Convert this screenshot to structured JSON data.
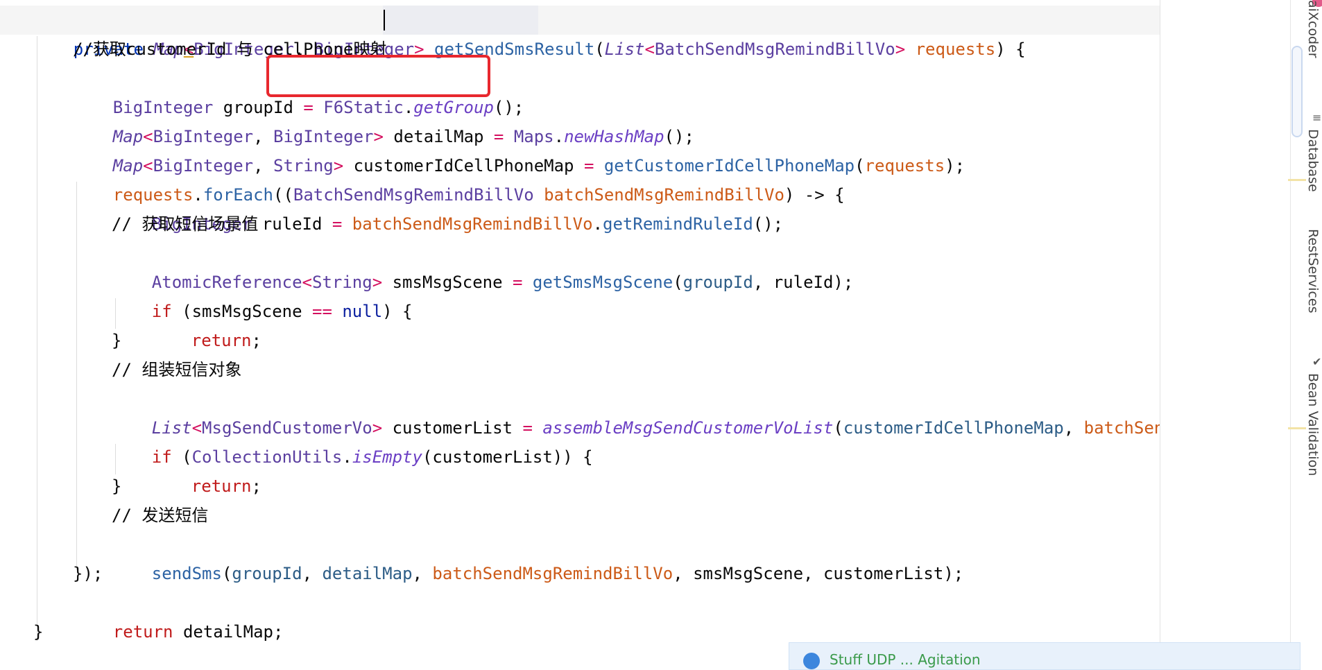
{
  "editor": {
    "method_signature": {
      "modifier": "private",
      "return_type": "Map",
      "lt": "<",
      "key_type": "BigInteger",
      "comma": ", ",
      "value_type": "BigInteger",
      "gt": ">",
      "method_name": "getSendSmsResult",
      "paren_open": "(",
      "param_type": "List",
      "param_generic_lt": "<",
      "param_generic": "BatchSendMsgRemindBillVo",
      "param_generic_gt": ">",
      "param_name": "requests",
      "tail": ") {"
    },
    "lines": {
      "l2_comment": "//获取customerId 与 cellPhone映射",
      "l3": {
        "type": "BigInteger",
        "name": " groupId ",
        "eq": "=",
        "cls": " F6Static",
        "dot": ".",
        "call": "getGroup",
        "tail": "();"
      },
      "l4": {
        "type": "Map",
        "lt": "<",
        "t1": "BigInteger",
        "c": ", ",
        "t2": "BigInteger",
        "gt": ">",
        "name": " detailMap ",
        "eq": "=",
        "cls": " Maps",
        "dot": ".",
        "call": "newHashMap",
        "tail": "();"
      },
      "l5": {
        "type": "Map",
        "lt": "<",
        "t1": "BigInteger",
        "c": ", ",
        "t2": "String",
        "gt": ">",
        "name": " customerIdCellPhoneMap ",
        "eq": "=",
        "call": " getCustomerIdCellPhoneMap",
        "po": "(",
        "arg": "requests",
        "tail": ");"
      },
      "l6": {
        "obj": "requests",
        "dot": ".",
        "call": "forEach",
        "po": "((",
        "type": "BatchSendMsgRemindBillVo",
        "sp": " ",
        "param": "batchSendMsgRemindBillVo",
        "tail": ") -> {"
      },
      "l7": {
        "type": "BigInteger",
        "name": " ruleId ",
        "eq": "=",
        "obj": " batchSendMsgRemindBillVo",
        "dot": ".",
        "call": "getRemindRuleId",
        "tail": "();"
      },
      "l8_comment": "// 获取短信场景值",
      "l9": {
        "type": "AtomicReference",
        "lt": "<",
        "t1": "String",
        "gt": ">",
        "name": " smsMsgScene ",
        "eq": "=",
        "call": " getSmsMsgScene",
        "po": "(",
        "a1": "groupId",
        "c": ", ",
        "a2": "ruleId",
        "tail": ");"
      },
      "l10": {
        "kw": "if",
        "po": " (smsMsgScene ",
        "op": "==",
        "sp": " ",
        "null": "null",
        "tail": ") {"
      },
      "l11": {
        "kw": "return",
        "tail": ";"
      },
      "l12": "}",
      "l13_comment": "// 组装短信对象",
      "l14": {
        "type": "List",
        "lt": "<",
        "t1": "MsgSendCustomerVo",
        "gt": ">",
        "name": " customerList ",
        "eq": "=",
        "call": " assembleMsgSendCustomerVoList",
        "po": "(",
        "a1": "customerIdCellPhoneMap",
        "c": ", ",
        "a2": "batchSendMsgRemindBillVo",
        "tail": ");"
      },
      "l15": {
        "kw": "if",
        "po": " (",
        "cls": "CollectionUtils",
        "dot": ".",
        "call": "isEmpty",
        "tail": "(customerList)) {"
      },
      "l16": {
        "kw": "return",
        "tail": ";"
      },
      "l17": "}",
      "l18_comment": "// 发送短信",
      "l19": {
        "call": "sendSms",
        "po": "(",
        "a1": "groupId",
        "c1": ", ",
        "a2": "detailMap",
        "c2": ", ",
        "a3": "batchSendMsgRemindBillVo",
        "rest": ", smsMsgScene, customerList);"
      },
      "l20": "});",
      "l21": {
        "kw": "return",
        "tail": " detailMap;"
      },
      "l22": "}"
    }
  },
  "right_toolbar": {
    "items": [
      "aiXcoder",
      "Database",
      "RestServices",
      "Bean Validation"
    ]
  },
  "notification": {
    "text": "Stuff UDP ... Agitation"
  },
  "colors": {
    "highlight_box": "#e8282e",
    "keyword": "#0033b3",
    "type": "#5b3fa0",
    "parameter": "#cc5a17",
    "comment": "#7a7a7a"
  }
}
